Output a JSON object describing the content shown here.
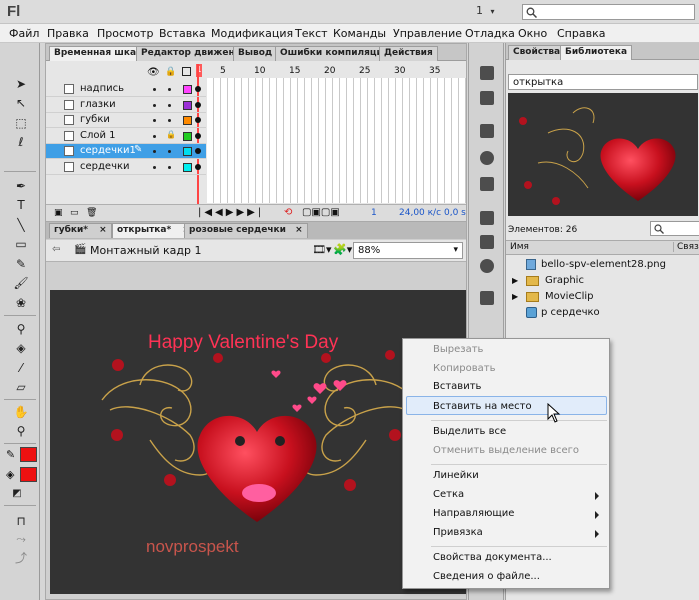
{
  "app": {
    "logo": "Fl",
    "workspace": "1",
    "search_placeholder": ""
  },
  "menu": [
    "Файл",
    "Правка",
    "Просмотр",
    "Вставка",
    "Модификация",
    "Текст",
    "Команды",
    "Управление",
    "Отладка",
    "Окно",
    "Справка"
  ],
  "timeline": {
    "tabs": [
      "Временная шкала",
      "Редактор движения",
      "Вывод",
      "Ошибки компиляции",
      "Действия"
    ],
    "frame_numbers": [
      "5",
      "10",
      "15",
      "20",
      "25",
      "30",
      "35"
    ],
    "current_frame": "1",
    "fps": "24,00 к/с",
    "time": "0,0 s",
    "layers": [
      {
        "name": "надпись",
        "color": "#ff44ff",
        "locked": false,
        "selected": false
      },
      {
        "name": "глазки",
        "color": "#9b2fd6",
        "locked": false,
        "selected": false
      },
      {
        "name": "губки",
        "color": "#ff8a00",
        "locked": false,
        "selected": false
      },
      {
        "name": "Слой 1",
        "color": "#22cc22",
        "locked": true,
        "selected": false
      },
      {
        "name": "сердечки1",
        "color": "#00ddee",
        "locked": false,
        "selected": true
      },
      {
        "name": "сердечки",
        "color": "#00eeee",
        "locked": false,
        "selected": false
      }
    ]
  },
  "document": {
    "tabs": [
      "губки*",
      "открытка*",
      "розовые сердечки"
    ],
    "breadcrumb": "Монтажный кадр 1",
    "zoom": "88%",
    "stage_title": "Happy Valentine's Day",
    "stage_watermark": "novprospekt"
  },
  "library": {
    "tabs": [
      "Свойства",
      "Библиотека"
    ],
    "document": "открытка",
    "count_label": "Элементов: 26",
    "col_name": "Имя",
    "col_link": "Связь",
    "items": [
      {
        "name": "bello-spv-element28.png",
        "type": "image"
      },
      {
        "name": "Graphic",
        "type": "folder"
      },
      {
        "name": "MovieClip",
        "type": "folder"
      },
      {
        "name": "р сердечко",
        "type": "symbol"
      }
    ]
  },
  "context_menu": {
    "items": [
      {
        "label": "Вырезать",
        "enabled": false,
        "submenu": false
      },
      {
        "label": "Копировать",
        "enabled": false,
        "submenu": false
      },
      {
        "label": "Вставить",
        "enabled": true,
        "submenu": false
      },
      {
        "label": "Вставить на место",
        "enabled": true,
        "submenu": false,
        "hovered": true
      },
      {
        "label": "Выделить все",
        "enabled": true,
        "submenu": false
      },
      {
        "label": "Отменить выделение всего",
        "enabled": false,
        "submenu": false
      },
      {
        "label": "Линейки",
        "enabled": true,
        "submenu": false
      },
      {
        "label": "Сетка",
        "enabled": true,
        "submenu": true
      },
      {
        "label": "Направляющие",
        "enabled": true,
        "submenu": true
      },
      {
        "label": "Привязка",
        "enabled": true,
        "submenu": true
      },
      {
        "label": "Свойства документа...",
        "enabled": true,
        "submenu": false
      },
      {
        "label": "Сведения о файле...",
        "enabled": true,
        "submenu": false
      }
    ]
  },
  "colors": {
    "stroke": "#ee1111",
    "fill": "#ee1111",
    "stage_bg": "#333333",
    "accent": "#3f9fe6"
  }
}
